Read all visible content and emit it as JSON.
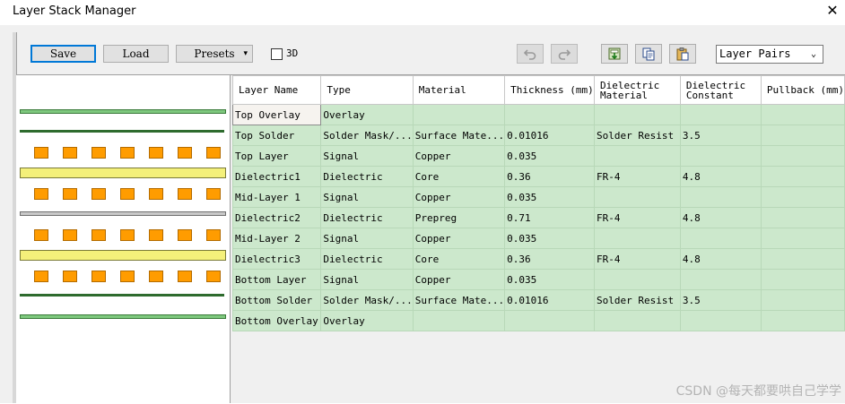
{
  "window": {
    "title": "Layer Stack Manager",
    "close_glyph": "✕"
  },
  "toolbar": {
    "save_label": "Save",
    "load_label": "Load",
    "presets_label": "Presets",
    "presets_caret": "▾",
    "three_d_label": "3D",
    "three_d_checked": false,
    "undo_icon": "undo-icon",
    "redo_icon": "redo-icon",
    "import_icon": "import-icon",
    "copy_icon": "copy-icon",
    "paste_icon": "paste-icon",
    "view_select": {
      "value": "Layer Pairs",
      "arrow": "⌄"
    }
  },
  "grid": {
    "columns": [
      "Layer Name",
      "Type",
      "Material",
      "Thickness (mm)",
      "Dielectric Material",
      "Dielectric Constant",
      "Pullback (mm)"
    ],
    "rows": [
      [
        "Top Overlay",
        "Overlay",
        "",
        "",
        "",
        "",
        ""
      ],
      [
        "Top Solder",
        "Solder Mask/...",
        "Surface Mate...",
        "0.01016",
        "Solder Resist",
        "3.5",
        ""
      ],
      [
        "Top Layer",
        "Signal",
        "Copper",
        "0.035",
        "",
        "",
        ""
      ],
      [
        "Dielectric1",
        "Dielectric",
        "Core",
        "0.36",
        "FR-4",
        "4.8",
        ""
      ],
      [
        "Mid-Layer 1",
        "Signal",
        "Copper",
        "0.035",
        "",
        "",
        ""
      ],
      [
        "Dielectric2",
        "Dielectric",
        "Prepreg",
        "0.71",
        "FR-4",
        "4.8",
        ""
      ],
      [
        "Mid-Layer 2",
        "Signal",
        "Copper",
        "0.035",
        "",
        "",
        ""
      ],
      [
        "Dielectric3",
        "Dielectric",
        "Core",
        "0.36",
        "FR-4",
        "4.8",
        ""
      ],
      [
        "Bottom Layer",
        "Signal",
        "Copper",
        "0.035",
        "",
        "",
        ""
      ],
      [
        "Bottom Solder",
        "Solder Mask/...",
        "Surface Mate...",
        "0.01016",
        "Solder Resist",
        "3.5",
        ""
      ],
      [
        "Bottom Overlay",
        "Overlay",
        "",
        "",
        "",
        "",
        ""
      ]
    ],
    "selected_cell": "Top Overlay"
  },
  "stack_visual": {
    "overlay_color": "#7ec87e",
    "solder_color": "#2e6b2e",
    "copper_color": "#ff9c00",
    "core_color": "#f4f07a",
    "prepreg_color": "#c8c8c8"
  },
  "colors": {
    "row_bg": "#cce8cc",
    "accent": "#0078d7"
  },
  "watermark": "CSDN @每天都要哄自己学学"
}
